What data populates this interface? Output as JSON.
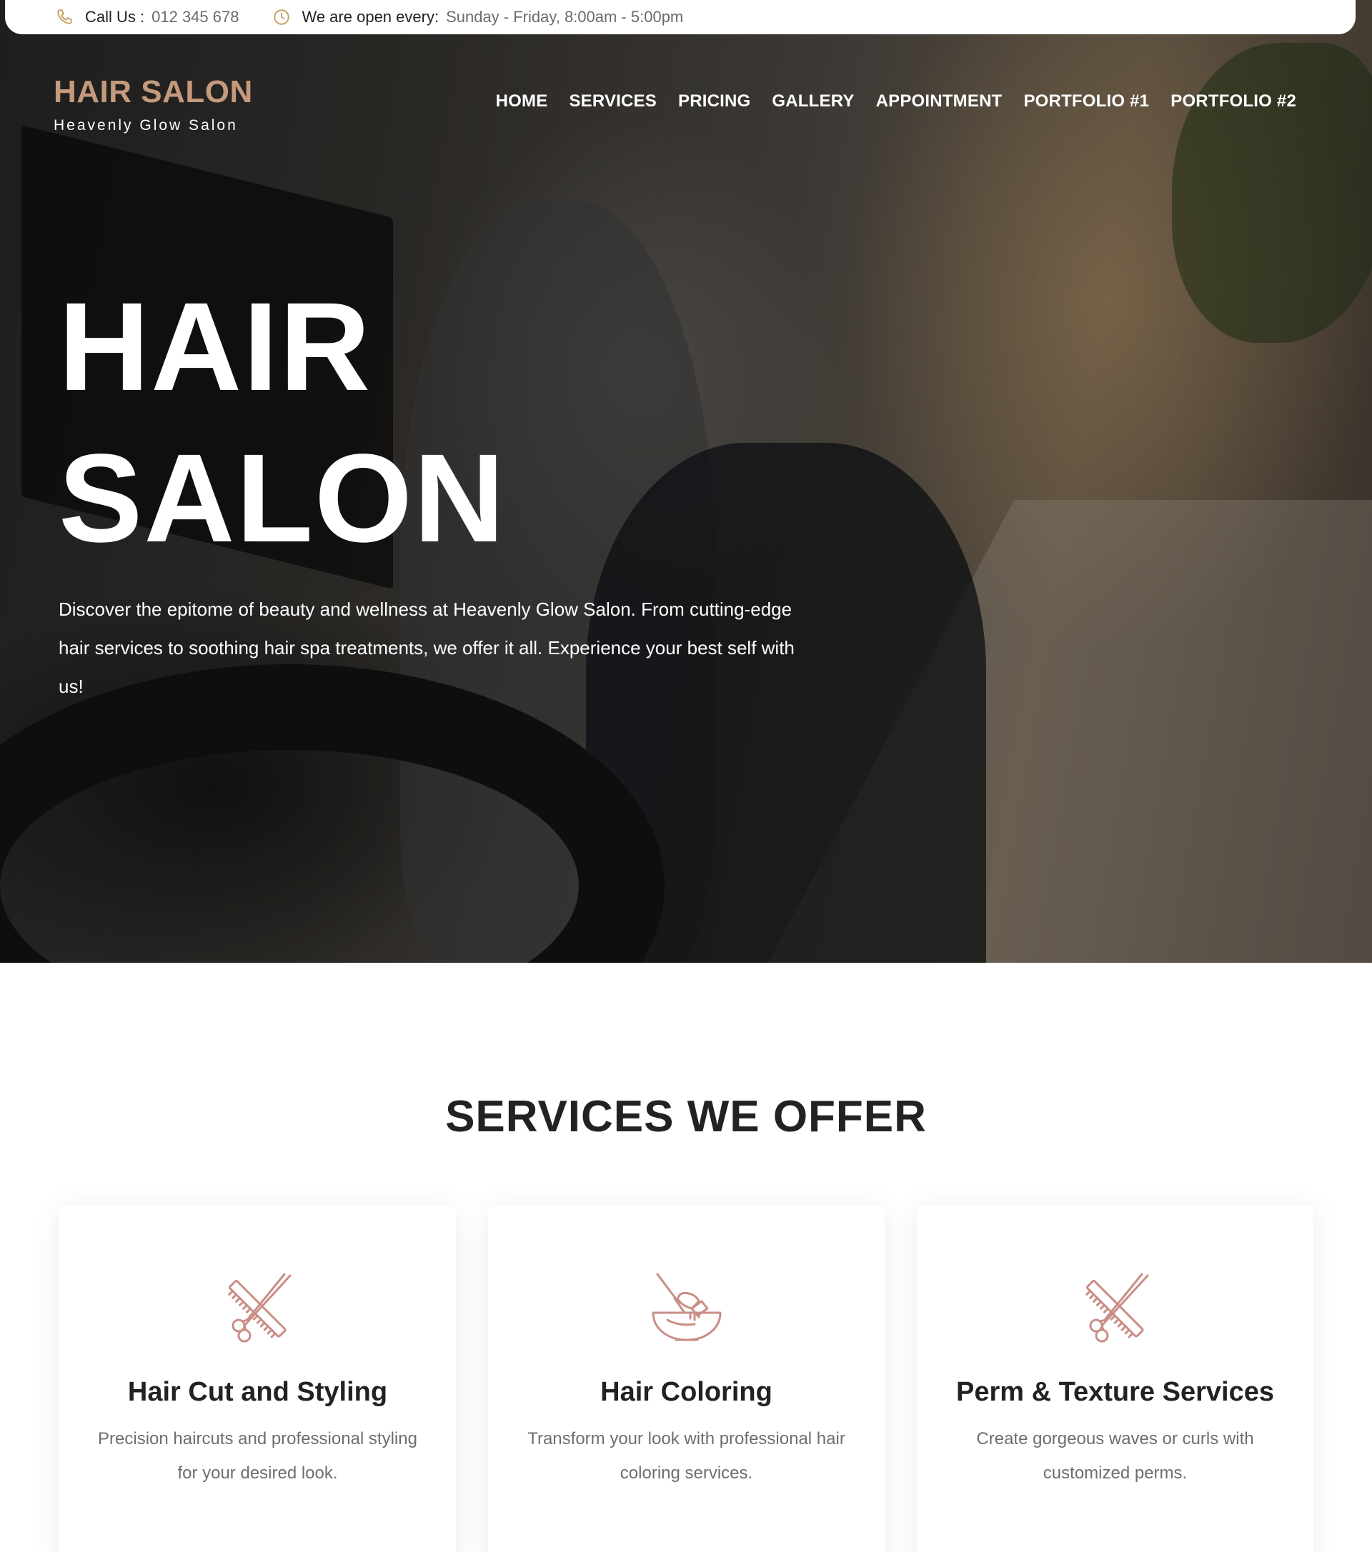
{
  "topbar": {
    "phone_label": "Call Us :",
    "phone_value": "012 345 678",
    "hours_label": "We are open every:",
    "hours_value": "Sunday - Friday, 8:00am - 5:00pm",
    "phone_icon": "phone-icon",
    "clock_icon": "clock-icon"
  },
  "brand": {
    "title": "HAIR SALON",
    "subtitle": "Heavenly Glow Salon"
  },
  "nav": {
    "items": [
      "HOME",
      "SERVICES",
      "PRICING",
      "GALLERY",
      "APPOINTMENT",
      "PORTFOLIO #1",
      "PORTFOLIO #2"
    ]
  },
  "hero": {
    "title_line1": "HAIR",
    "title_line2": "SALON",
    "description": "Discover the epitome of beauty and wellness at Heavenly Glow Salon. From cutting-edge hair services to soothing hair spa treatments, we offer it all. Experience your best self with us!"
  },
  "services": {
    "heading": "SERVICES WE OFFER",
    "items": [
      {
        "title": "Hair Cut and Styling",
        "description": "Precision haircuts and professional styling for your desired look.",
        "icon": "scissors-comb-icon"
      },
      {
        "title": "Hair Coloring",
        "description": "Transform your look with professional hair coloring services.",
        "icon": "hair-dye-bowl-icon"
      },
      {
        "title": "Perm & Texture Services",
        "description": "Create gorgeous waves or curls with customized perms.",
        "icon": "scissors-comb-icon"
      }
    ]
  },
  "colors": {
    "accent": "#c49a7c",
    "icon": "#c98e86",
    "topbar_icon": "#c8a165",
    "heading": "#222222",
    "muted": "#6e6e6e"
  }
}
